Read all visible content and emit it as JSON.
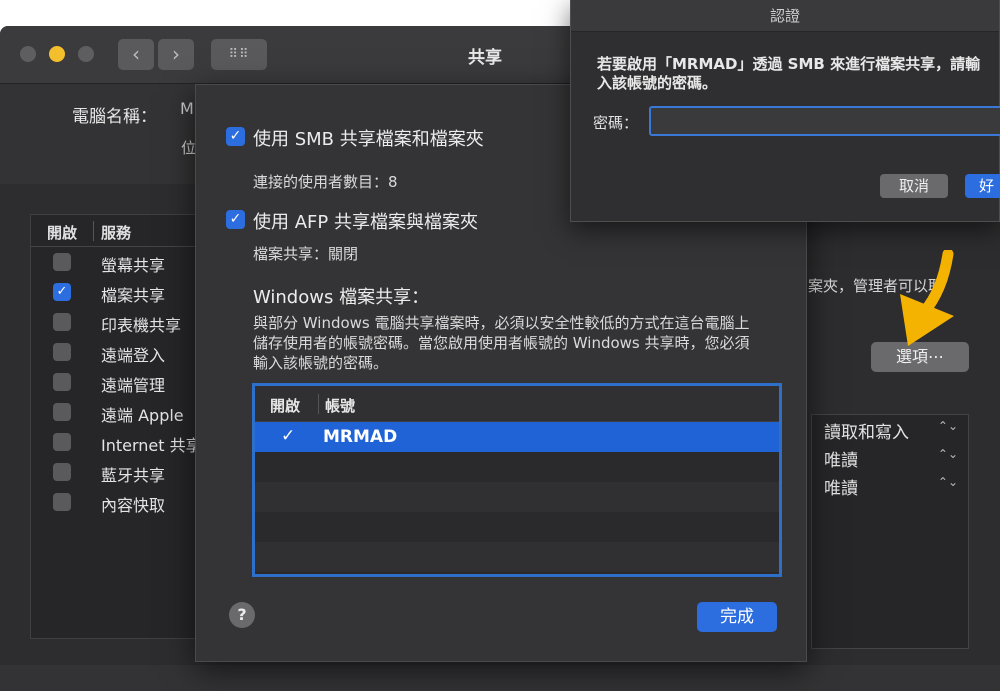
{
  "window": {
    "title": "共享",
    "computer_name_label": "電腦名稱：",
    "computer_name_value": "M",
    "address_prefix": "位"
  },
  "services": {
    "col_enable": "開啟",
    "col_service": "服務",
    "items": [
      {
        "label": "螢幕共享",
        "checked": false
      },
      {
        "label": "檔案共享",
        "checked": true
      },
      {
        "label": "印表機共享",
        "checked": false
      },
      {
        "label": "遠端登入",
        "checked": false
      },
      {
        "label": "遠端管理",
        "checked": false
      },
      {
        "label": "遠端 Apple",
        "checked": false
      },
      {
        "label": "Internet 共享",
        "checked": false
      },
      {
        "label": "藍牙共享",
        "checked": false
      },
      {
        "label": "內容快取",
        "checked": false
      }
    ]
  },
  "right_panel": {
    "desc_fragment": "案夾，管理者可以取",
    "options_button": "選項⋯",
    "permissions": [
      "讀取和寫入",
      "唯讀",
      "唯讀"
    ]
  },
  "options_sheet": {
    "smb_label": "使用 SMB 共享檔案和檔案夾",
    "connected_users": "連接的使用者數目：8",
    "afp_label": "使用 AFP 共享檔案與檔案夾",
    "afp_status": "檔案共享：關閉",
    "windows_title": "Windows 檔案共享：",
    "windows_desc": "與部分 Windows 電腦共享檔案時，必須以安全性較低的方式在這台電腦上儲存使用者的帳號密碼。當您啟用使用者帳號的 Windows 共享時，您必須輸入該帳號的密碼。",
    "table_col_enable": "開啟",
    "table_col_account": "帳號",
    "accounts": [
      {
        "name": "MRMAD",
        "enabled": true
      }
    ],
    "help_label": "?",
    "done_label": "完成"
  },
  "auth_dialog": {
    "title": "認證",
    "message": "若要啟用「MRMAD」透過 SMB 來進行檔案共享，請輸\n入該帳號的密碼。",
    "password_label": "密碼：",
    "password_value": "",
    "cancel_label": "取消",
    "ok_label": "好"
  },
  "colors": {
    "accent": "#2c6ee0",
    "annotation_arrow": "#f5b301"
  },
  "icons": {
    "back": "chevron-left-icon",
    "forward": "chevron-right-icon",
    "grid": "grid-icon",
    "check": "checkmark-icon",
    "stepper": "up-down-stepper-icon",
    "arrow": "annotation-arrow-icon"
  }
}
